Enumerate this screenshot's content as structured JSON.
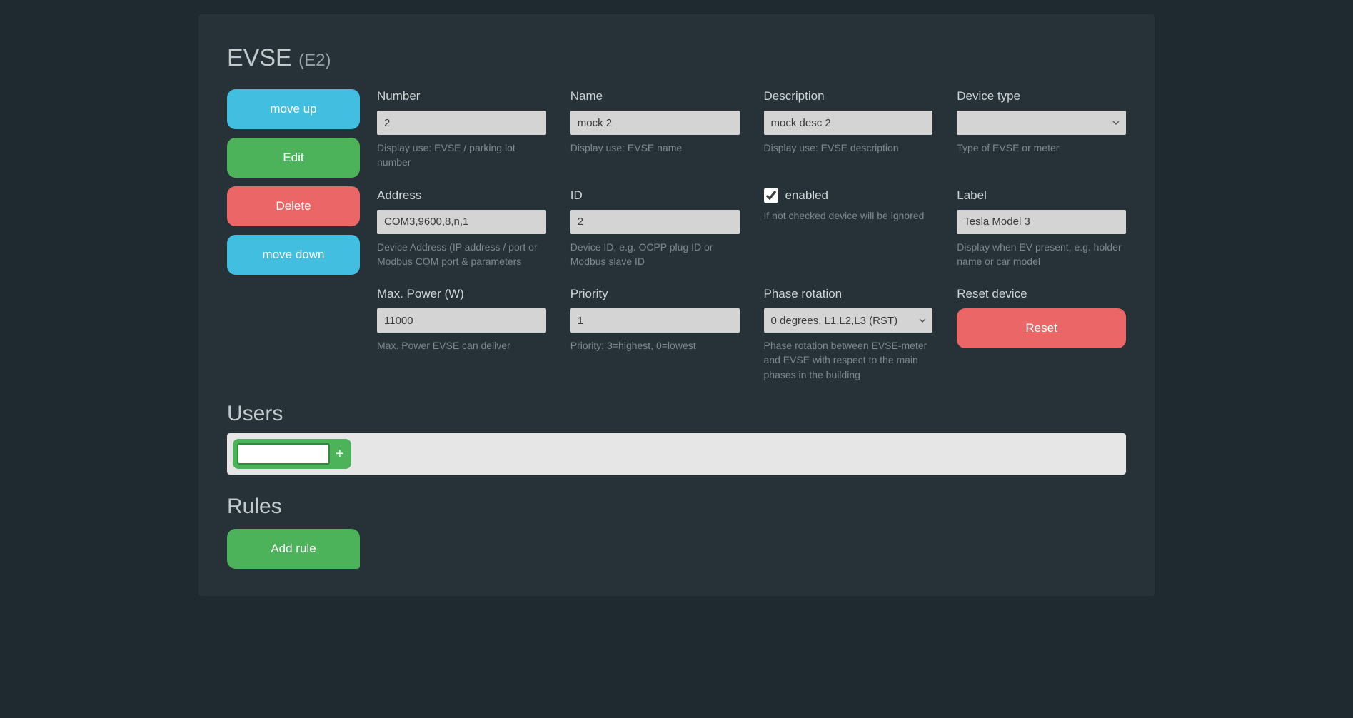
{
  "header": {
    "title": "EVSE",
    "subtitle": "(E2)"
  },
  "sideButtons": {
    "moveUp": "move up",
    "edit": "Edit",
    "delete": "Delete",
    "moveDown": "move down"
  },
  "fields": {
    "number": {
      "label": "Number",
      "value": "2",
      "help": "Display use: EVSE / parking lot number"
    },
    "name": {
      "label": "Name",
      "value": "mock 2",
      "help": "Display use: EVSE name"
    },
    "description": {
      "label": "Description",
      "value": "mock desc 2",
      "help": "Display use: EVSE description"
    },
    "deviceType": {
      "label": "Device type",
      "value": "",
      "help": "Type of EVSE or meter"
    },
    "address": {
      "label": "Address",
      "value": "COM3,9600,8,n,1",
      "help": "Device Address (IP address / port or Modbus COM port & parameters"
    },
    "id": {
      "label": "ID",
      "value": "2",
      "help": "Device ID, e.g. OCPP plug ID or Modbus slave ID"
    },
    "enabled": {
      "checked": true,
      "label": "enabled",
      "help": "If not checked device will be ignored"
    },
    "labelField": {
      "label": "Label",
      "value": "Tesla Model 3",
      "help": "Display when EV present, e.g. holder name or car model"
    },
    "maxPower": {
      "label": "Max. Power (W)",
      "value": "11000",
      "help": "Max. Power EVSE can deliver"
    },
    "priority": {
      "label": "Priority",
      "value": "1",
      "help": "Priority: 3=highest, 0=lowest"
    },
    "phase": {
      "label": "Phase rotation",
      "value": "0 degrees, L1,L2,L3 (RST)",
      "help": "Phase rotation between EVSE-meter and EVSE with respect to the main phases in the building"
    },
    "reset": {
      "label": "Reset device",
      "buttonLabel": "Reset"
    }
  },
  "sections": {
    "users": "Users",
    "rules": "Rules"
  },
  "usersAdd": {
    "value": "",
    "plus": "+"
  },
  "addRule": "Add rule"
}
